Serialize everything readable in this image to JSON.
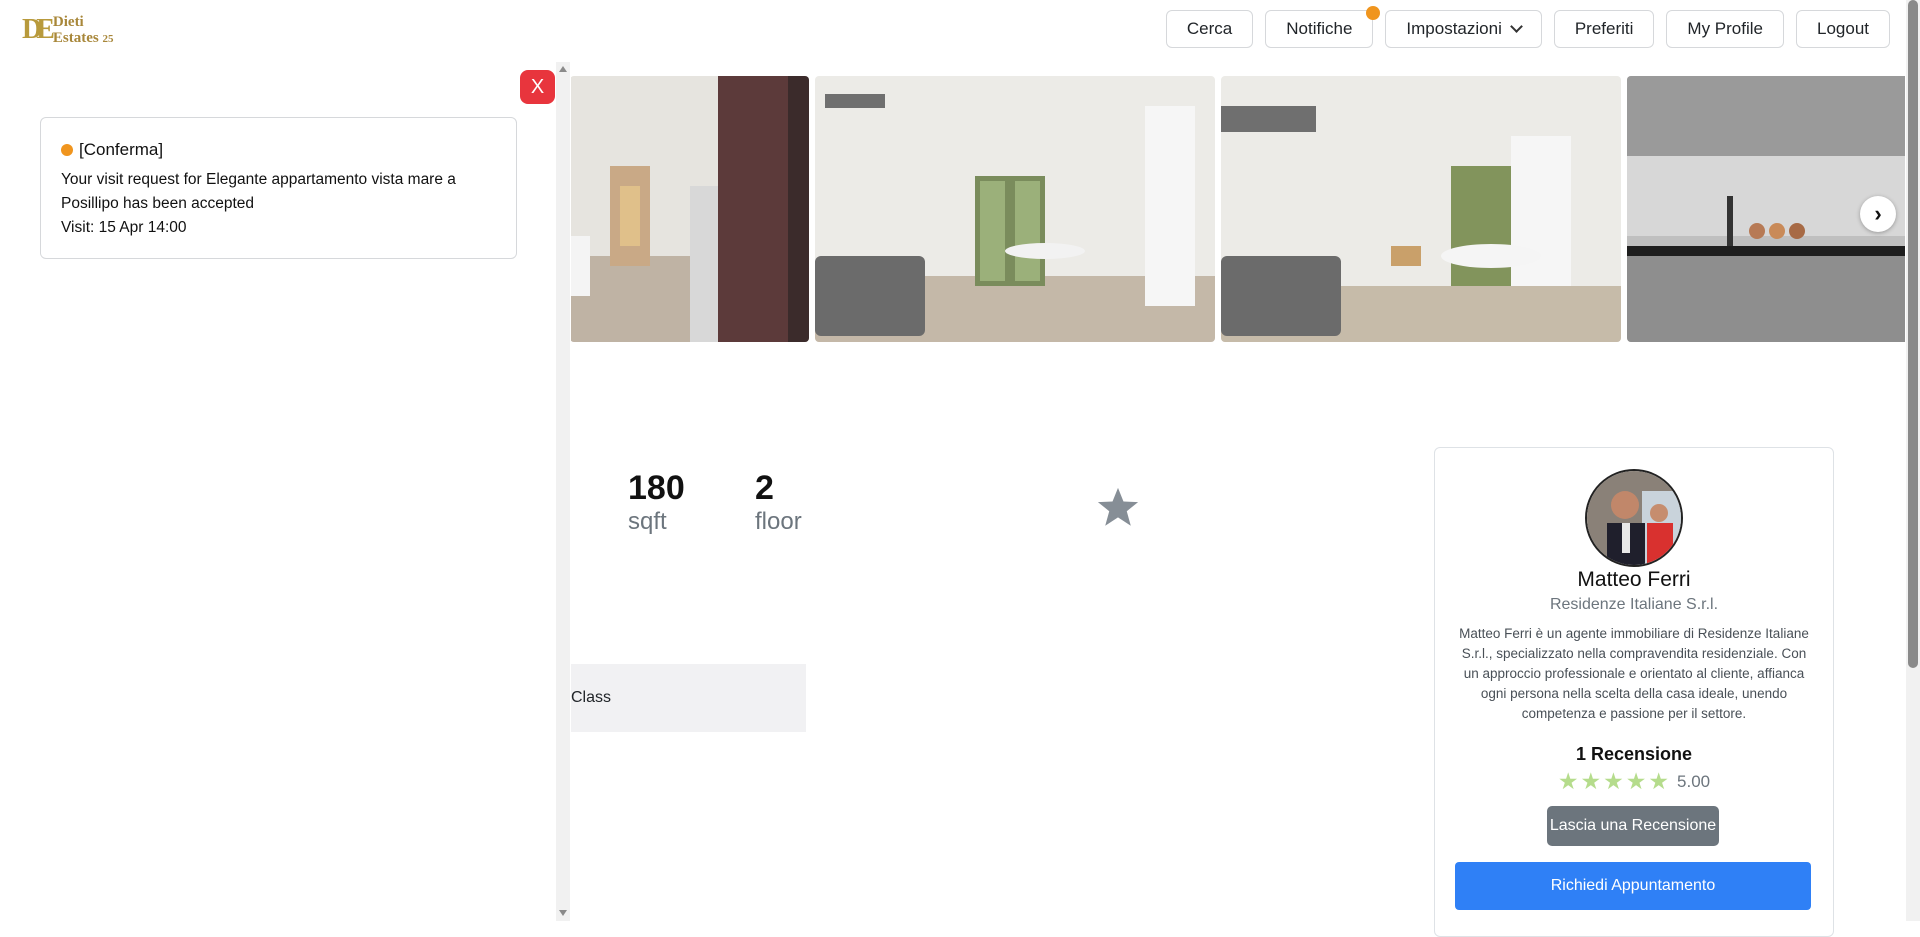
{
  "brand": {
    "logo_mark": "DE",
    "line1": "Dieti",
    "line2": "Estates",
    "suffix": "25"
  },
  "nav": {
    "cerca": "Cerca",
    "notifiche": "Notifiche",
    "impostazioni": "Impostazioni",
    "preferiti": "Preferiti",
    "profile": "My Profile",
    "logout": "Logout"
  },
  "gallery": {
    "next_glyph": "›"
  },
  "stats": [
    {
      "value": "180",
      "unit": "sqft"
    },
    {
      "value": "2",
      "unit": "floor"
    }
  ],
  "class_label": "Class",
  "agent": {
    "name": "Matteo Ferri",
    "company": "Residenze Italiane S.r.l.",
    "bio": "Matteo Ferri è un agente immobiliare di Residenze Italiane S.r.l., specializzato nella compravendita residenziale. Con un approccio professionale e orientato al cliente, affianca ogni persona nella scelta della casa ideale, unendo competenza e passione per il settore.",
    "reviews_count": "1 Recensione",
    "rating_text": "5.00",
    "rating_stars": 5,
    "review_button": "Lascia una Recensione",
    "appointment_button": "Richiedi Appuntamento"
  },
  "notification": {
    "close_glyph": "X",
    "title": "[Conferma]",
    "message": "Your visit request for Elegante appartamento vista mare a Posillipo has been accepted",
    "visit": "Visit: 15 Apr 14:00"
  },
  "colors": {
    "accent": "#2f80f6",
    "danger": "#e8353d",
    "notify": "#f0951e",
    "star": "#b5dc8c"
  }
}
